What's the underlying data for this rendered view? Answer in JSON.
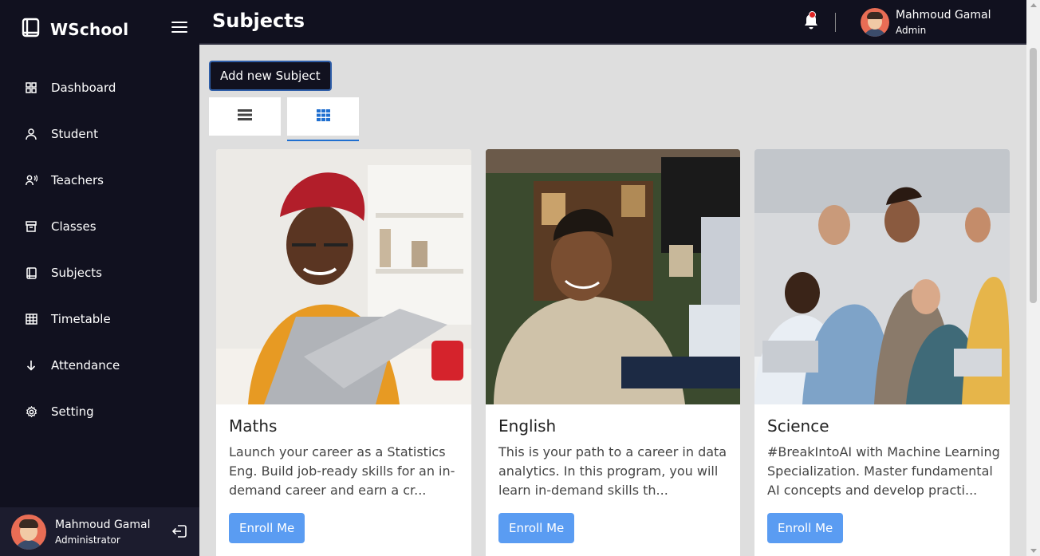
{
  "brand": {
    "name": "WSchool",
    "icon": "book-icon"
  },
  "sidebar": {
    "items": [
      {
        "label": "Dashboard",
        "icon": "grid-icon"
      },
      {
        "label": "Student",
        "icon": "user-icon"
      },
      {
        "label": "Teachers",
        "icon": "teacher-icon"
      },
      {
        "label": "Classes",
        "icon": "archive-icon"
      },
      {
        "label": "Subjects",
        "icon": "book-icon"
      },
      {
        "label": "Timetable",
        "icon": "table-icon"
      },
      {
        "label": "Attendance",
        "icon": "arrow-down-icon"
      },
      {
        "label": "Setting",
        "icon": "gear-icon"
      }
    ],
    "footer": {
      "name": "Mahmoud Gamal",
      "role": "Administrator"
    }
  },
  "header": {
    "title": "Subjects",
    "user": {
      "name": "Mahmoud Gamal",
      "role": "Admin"
    }
  },
  "main": {
    "add_button": "Add new Subject",
    "cards": [
      {
        "title": "Maths",
        "description": "Launch your career as a Statistics Eng. Build job-ready skills for an in-demand career and earn a cr...",
        "button": "Enroll Me"
      },
      {
        "title": "English",
        "description": "This is your path to a career in data analytics. In this program, you will learn in-demand skills th...",
        "button": "Enroll Me"
      },
      {
        "title": "Science",
        "description": "#BreakIntoAI with Machine Learning Specialization. Master fundamental AI concepts and develop practi...",
        "button": "Enroll Me"
      }
    ]
  },
  "colors": {
    "sidebar_bg": "#11111f",
    "accent": "#5a9cf2",
    "tab_active": "#1f6fd0",
    "notification": "#e02424"
  }
}
